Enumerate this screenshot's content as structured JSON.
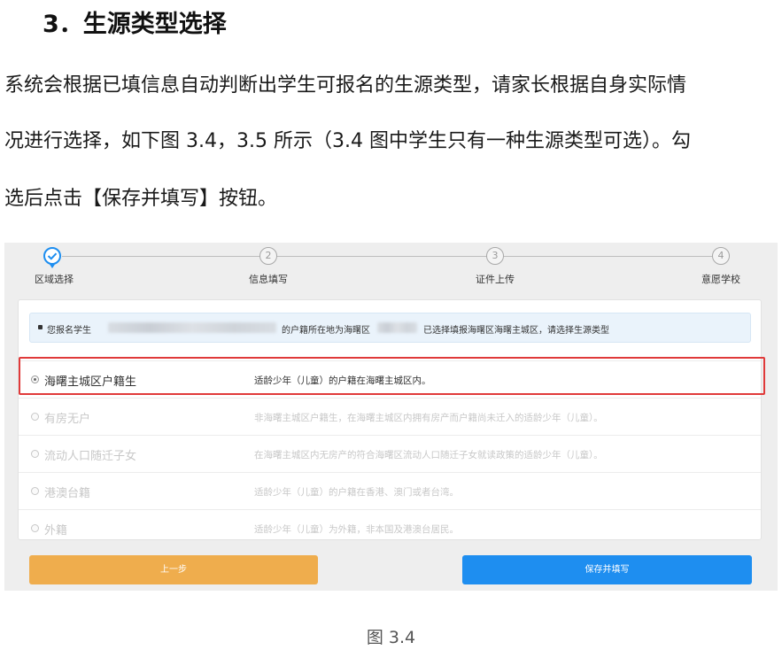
{
  "heading": "3．生源类型选择",
  "paragraph": {
    "line1": "系统会根据已填信息自动判断出学生可报名的生源类型，请家长根据自身实际情",
    "line2": "况进行选择，如下图 3.4，3.5 所示（3.4 图中学生只有一种生源类型可选）。勾",
    "line3": "选后点击【保存并填写】按钮。"
  },
  "steps": [
    {
      "num": "",
      "label": "区域选择"
    },
    {
      "num": "2",
      "label": "信息填写"
    },
    {
      "num": "3",
      "label": "证件上传"
    },
    {
      "num": "4",
      "label": "意愿学校"
    }
  ],
  "notice": {
    "part1": "您报名学生",
    "part2": "的户籍所在地为海曙区",
    "part3": "已选择填报海曙区海曙主城区，请选择生源类型"
  },
  "options": [
    {
      "name": "海曙主城区户籍生",
      "desc": "适龄少年（儿童）的户籍在海曙主城区内。",
      "selected": true
    },
    {
      "name": "有房无户",
      "desc": "非海曙主城区户籍生，在海曙主城区内拥有房产而户籍尚未迁入的适龄少年（儿童）。",
      "selected": false
    },
    {
      "name": "流动人口随迁子女",
      "desc": "在海曙主城区内无房产的符合海曙区流动人口随迁子女就读政策的适龄少年（儿童）。",
      "selected": false
    },
    {
      "name": "港澳台籍",
      "desc": "适龄少年（儿童）的户籍在香港、澳门或者台湾。",
      "selected": false
    },
    {
      "name": "外籍",
      "desc": "适龄少年（儿童）为外籍，非本国及港澳台居民。",
      "selected": false
    }
  ],
  "buttons": {
    "prev": "上一步",
    "save": "保存并填写"
  },
  "caption": "图 3.4",
  "colors": {
    "highlight": "#e03a3a",
    "prev_button": "#efad4d",
    "save_button": "#1e8ef0",
    "step_active": "#1e8ef0"
  }
}
